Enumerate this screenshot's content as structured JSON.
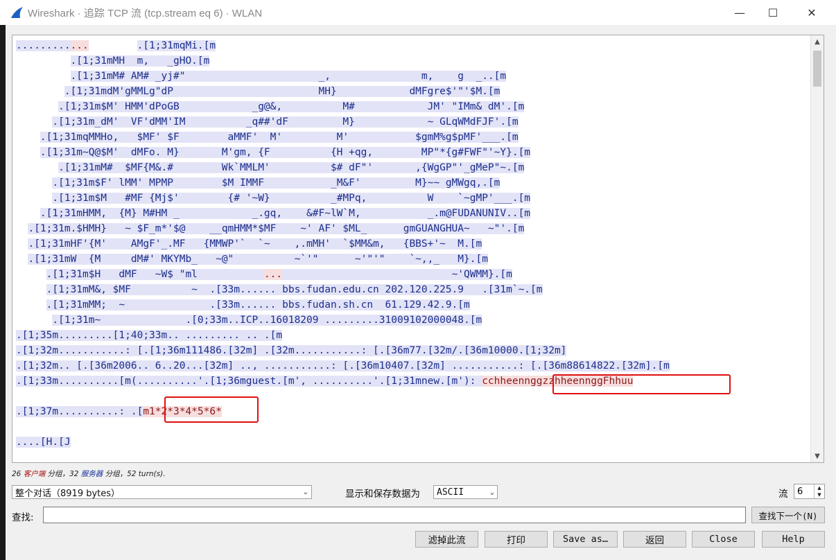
{
  "window": {
    "title": "Wireshark · 追踪 TCP 流 (tcp.stream eq 6) · WLAN",
    "min_glyph": "—",
    "max_glyph": "☐",
    "close_glyph": "✕"
  },
  "stream": {
    "lines": [
      [
        [
          "c",
          "........."
        ],
        [
          "s",
          "..."
        ],
        [
          "b",
          "        "
        ],
        [
          "c",
          ".[1;31mqMi.[m"
        ]
      ],
      [
        [
          "b",
          "         "
        ],
        [
          "c",
          ".[1;31mMH  m,   _gHO.[m"
        ]
      ],
      [
        [
          "b",
          "         "
        ],
        [
          "c",
          ".[1;31mM# AM# _yj#\"                      _,               m,    g  _..[m"
        ]
      ],
      [
        [
          "b",
          "        "
        ],
        [
          "c",
          ".[1;31mdM'gMMLg\"dP                        MH}            dMFgre$'\"'$M.[m"
        ]
      ],
      [
        [
          "b",
          "       "
        ],
        [
          "c",
          ".[1;31m$M' HMM'dPoGB            _g@&,          M#            JM' \"IMm& dM'.[m"
        ]
      ],
      [
        [
          "b",
          "      "
        ],
        [
          "c",
          ".[1;31m_dM'  VF'dMM'IM          _q##'dF         M}            ~ GLqWMdFJF'.[m"
        ]
      ],
      [
        [
          "b",
          "    "
        ],
        [
          "c",
          ".[1;31mqMMHo,   $MF' $F        aMMF'  M'         M'           $gmM%g$pMF'___.[m"
        ]
      ],
      [
        [
          "b",
          "    "
        ],
        [
          "c",
          ".[1;31m~Q@$M'  dMFo. M}       M'gm, {F          {H +qg,        MP\"*{g#FWF\"'~Y}.[m"
        ]
      ],
      [
        [
          "b",
          "       "
        ],
        [
          "c",
          ".[1;31mM#  $MF{M&.#        Wk`MMLM'          $# dF\"'       ,{WgGP\"'_gMeP\"~.[m"
        ]
      ],
      [
        [
          "b",
          "      "
        ],
        [
          "c",
          ".[1;31m$F' lMM' MPMP        $M IMMF           _M&F'         M}~~ gMWgq,.[m"
        ]
      ],
      [
        [
          "b",
          "      "
        ],
        [
          "c",
          ".[1;31m$M   #MF {Mj$'        {# '~W}          _#MPq,          W    `~gMP'___.[m"
        ]
      ],
      [
        [
          "b",
          "    "
        ],
        [
          "c",
          ".[1;31mHMM,  {M} M#HM _            _.gq,    &#F~lW`M,           _.m@FUDANUNIV..[m"
        ]
      ],
      [
        [
          "b",
          "  "
        ],
        [
          "c",
          ".[1;31m.$HMH}   ~ $F_m*'$@    __qmHMM*$MF    ~' AF' $ML_      gmGUANGHUA~   ~\"'.[m"
        ]
      ],
      [
        [
          "b",
          "  "
        ],
        [
          "c",
          ".[1;31mHF'{M'    AMgF'_.MF   {MMWP'`  `~    ,.mMH'  `$MM&m,   {BBS+'~  M.[m"
        ]
      ],
      [
        [
          "b",
          "  "
        ],
        [
          "c",
          ".[1;31mW  {M     dM#' MKYMb_   ~@\"          ~`'\"      ~'\"'\"    `~,,_   M}.[m"
        ]
      ],
      [
        [
          "b",
          "     "
        ],
        [
          "c",
          ".[1;31m$H   dMF   ~W$ \"ml           "
        ],
        [
          "s",
          "..."
        ],
        [
          "c",
          "                            ~'QWMM}.[m"
        ]
      ],
      [
        [
          "b",
          "     "
        ],
        [
          "c",
          ".[1;31mM&, $MF          ~  .[33m...... bbs.fudan.edu.cn 202.120.225.9   .[31m`~.[m"
        ]
      ],
      [
        [
          "b",
          "     "
        ],
        [
          "c",
          ".[1;31mMM;  ~              .[33m...... bbs.fudan.sh.cn  61.129.42.9.[m"
        ]
      ],
      [
        [
          "b",
          "      "
        ],
        [
          "c",
          ".[1;31m~              .[0;33m..ICP..16018209 .........31009102000048.[m"
        ]
      ],
      [
        [
          "c",
          ".[1;35m.........[1;40;33m.. ......... .. .[m"
        ]
      ],
      [
        [
          "c",
          ".[1;32m...........: [.[1;36m111486.[32m] .[32m...........: [.[36m77.[32m/.[36m10000.[1;32m]"
        ]
      ],
      [
        [
          "c",
          ".[1;32m.. [.[36m2006.. 6..20...[32m] .., ...........: [.[36m10407.[32m] ...........: [.[36m88614822.[32m].[m"
        ]
      ],
      [
        [
          "c",
          ".[1;33m..........[m(..........'.[1;36mguest.[m', ..........'.[1;31mnew.[m'): "
        ],
        [
          "s",
          "cchheennggzzhheennggFhhuu"
        ]
      ],
      [
        [
          "b",
          " "
        ]
      ],
      [
        [
          "c",
          ".[1;37m..........: .["
        ],
        [
          "s",
          "m1*2*3*4*5*6*"
        ]
      ],
      [
        [
          "b",
          " "
        ]
      ],
      [
        [
          "c",
          "....[H.[J"
        ]
      ]
    ]
  },
  "stats": {
    "count_client": "26",
    "client_label": "客户端",
    "mid": " 分组，32 ",
    "server_label": "服务器",
    "tail": " 分组，52 turn(s)."
  },
  "controls": {
    "conversation_select": "整个对话（8919 bytes）",
    "display_label": "显示和保存数据为",
    "format_select": "ASCII",
    "stream_label": "流",
    "stream_value": "6",
    "find_label": "查找:",
    "find_value": "",
    "find_next_button": "查找下一个(N)"
  },
  "buttons": {
    "filter_out": "滤掉此流",
    "print": "打印",
    "save_as": "Save as…",
    "back": "返回",
    "close": "Close",
    "help": "Help"
  },
  "colors": {
    "client_bg": "#e3e3f7",
    "client_fg": "#1c2f8a",
    "server_bg": "#f7dede",
    "server_fg": "#8a1a1a",
    "highlight_box": "#e01010"
  }
}
